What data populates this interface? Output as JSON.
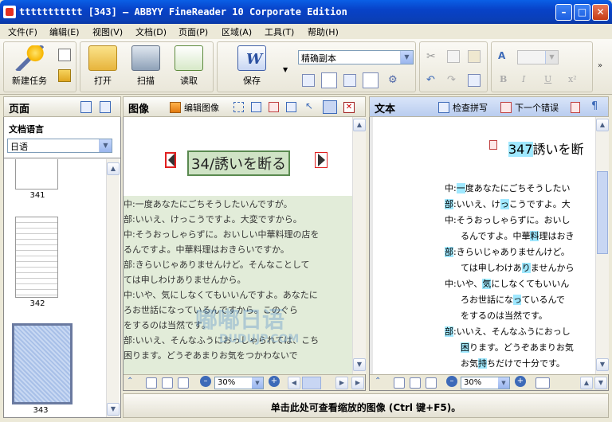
{
  "window": {
    "title": "ttttttttttt [343] – ABBYY FineReader 10 Corporate Edition"
  },
  "menu": [
    "文件(F)",
    "编辑(E)",
    "视图(V)",
    "文档(D)",
    "页面(P)",
    "区域(A)",
    "工具(T)",
    "帮助(H)"
  ],
  "toolbar": {
    "new_task": "新建任务",
    "open": "打开",
    "scan": "扫描",
    "read": "读取",
    "save": "保存",
    "format_mode": "精确副本"
  },
  "pages_panel": {
    "title": "页面",
    "doc_lang_label": "文档语言",
    "doc_lang_value": "日语",
    "thumbs": [
      "341",
      "342",
      "343"
    ]
  },
  "image_panel": {
    "title": "图像",
    "edit_image": "编辑图像",
    "heading": "34/誘いを断る",
    "watermark": "嘟嘟日语",
    "watermark_sub": "DUDUJP.COM",
    "lines": [
      "中:一度あなたにごちそうしたいんですが。",
      "部:いいえ、けっこうですよ。大変ですから。",
      "中:そうおっしゃらずに。おいしい中華料理の店を",
      "    るんですよ。中華料理はおきらいですか。",
      "部:きらいじゃありませんけど。そんなことして",
      "    ては申しわけありませんから。",
      "中:いや、気にしなくてもいいんですよ。あなたに",
      "    ろお世話になっているんですから。このぐら",
      "    をするのは当然です。",
      "部:いいえ、そんなふうにおっしゃられては、こち",
      "    困ります。どうぞあまりお気をつかわないで"
    ],
    "zoom": "30%"
  },
  "text_panel": {
    "title": "文本",
    "spell_check": "检查拼写",
    "next_error": "下一个错误",
    "heading": "347誘いを断",
    "zoom": "30%"
  },
  "status": {
    "text": "单击此处可查看缩放的图像 (Ctrl 键+F5)。"
  },
  "colors": {
    "title_bar": "#0a5fe6",
    "highlight": "#9fe8ff",
    "image_bg": "#e2ecd9"
  }
}
